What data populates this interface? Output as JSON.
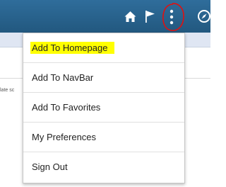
{
  "header": {
    "icons": [
      "home-icon",
      "flag-icon",
      "actions-menu-icon",
      "navigator-compass-icon"
    ],
    "accent_color": "#2a6590"
  },
  "background": {
    "partial_text": "late sc"
  },
  "menu": {
    "items": [
      {
        "label": "Add To Homepage",
        "highlighted": true
      },
      {
        "label": "Add To NavBar"
      },
      {
        "label": "Add To Favorites"
      },
      {
        "label": "My Preferences"
      },
      {
        "label": "Sign Out"
      }
    ],
    "highlight_color": "#ffff00"
  },
  "annotation": {
    "type": "hand-drawn circle",
    "color": "#e01010",
    "target": "actions-menu-icon"
  }
}
